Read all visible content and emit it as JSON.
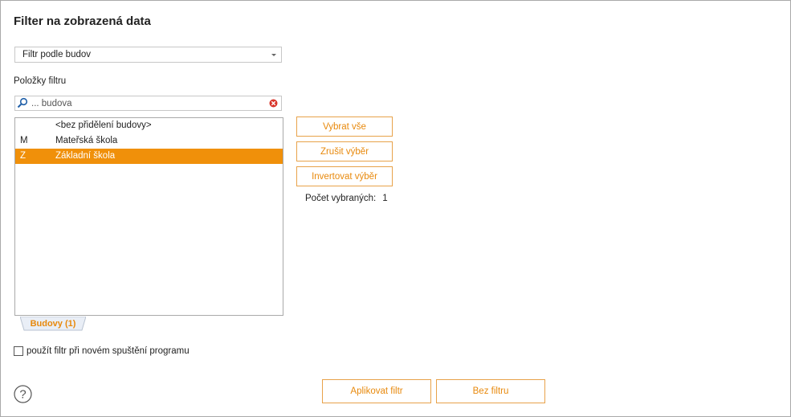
{
  "dialog": {
    "title": "Filter na zobrazená data"
  },
  "filter_select": {
    "value": "Filtr podle budov",
    "icon": "chevron-down-icon"
  },
  "items_label": "Položky filtru",
  "search": {
    "placeholder": "... budova",
    "value": ""
  },
  "list": {
    "items": [
      {
        "code": "",
        "name": "<bez přidělení budovy>",
        "selected": false
      },
      {
        "code": "M",
        "name": "Mateřská škola",
        "selected": false
      },
      {
        "code": "Z",
        "name": "Základní škola",
        "selected": true
      }
    ]
  },
  "tab": {
    "label": "Budovy (1)"
  },
  "actions": {
    "select_all": "Vybrat vše",
    "clear_selection": "Zrušit výběr",
    "invert_selection": "Invertovat výběr"
  },
  "selected_count": {
    "label": "Počet vybraných:",
    "value": "1"
  },
  "remember_filter": {
    "label": "použít filtr při novém spuštění programu",
    "checked": false
  },
  "footer": {
    "apply": "Aplikovat filtr",
    "no_filter": "Bez filtru"
  },
  "colors": {
    "accent": "#f0900a",
    "button_text": "#e8890c",
    "button_border": "#e8a24a"
  }
}
